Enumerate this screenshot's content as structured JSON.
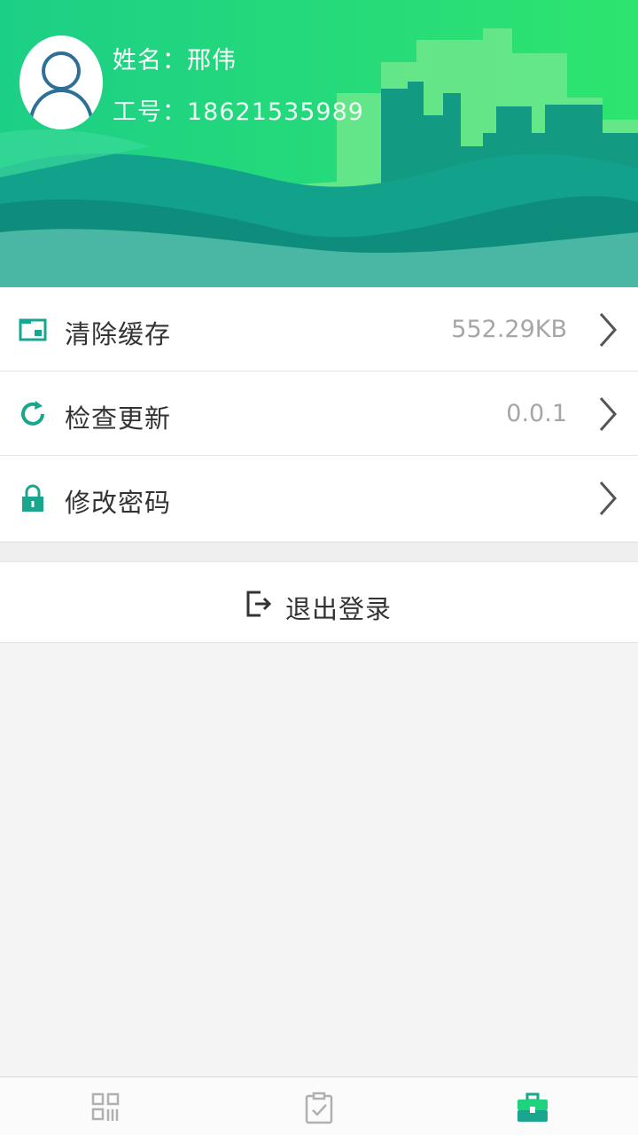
{
  "profile": {
    "name_label": "姓名：",
    "name_value": "邢伟",
    "id_label": "工号：",
    "id_value": "18621535989",
    "avatar_icon": "user-avatar-icon"
  },
  "menu": {
    "items": [
      {
        "label": "清除缓存",
        "value": "552.29KB",
        "icon": "folder-icon"
      },
      {
        "label": "检查更新",
        "value": "0.0.1",
        "icon": "refresh-icon"
      },
      {
        "label": "修改密码",
        "value": "",
        "icon": "lock-icon"
      }
    ]
  },
  "logout": {
    "label": "退出登录",
    "icon": "logout-icon"
  },
  "tabbar": {
    "tabs": [
      {
        "icon": "qr-scan-icon",
        "active": false
      },
      {
        "icon": "clipboard-check-icon",
        "active": false
      },
      {
        "icon": "briefcase-icon",
        "active": true
      }
    ]
  },
  "colors": {
    "accent": "#1aa58e",
    "header_green": "#1fd97e",
    "header_teal": "#12a28c",
    "tab_inactive": "#b0b0b0"
  }
}
